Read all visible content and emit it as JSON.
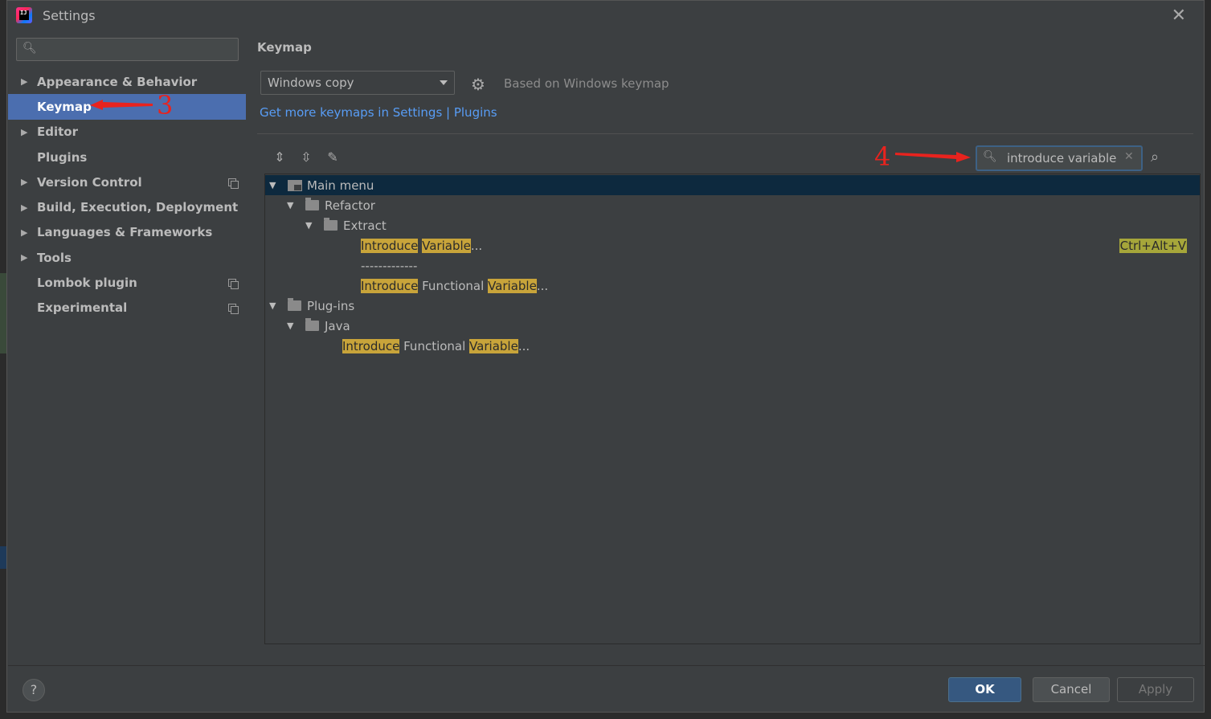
{
  "window": {
    "title": "Settings",
    "app_logo_text": "IJ"
  },
  "sidebar": {
    "search_placeholder": "",
    "items": [
      {
        "label": "Appearance & Behavior",
        "expandable": true,
        "selected": false,
        "project_level": false
      },
      {
        "label": "Keymap",
        "expandable": false,
        "selected": true,
        "project_level": false
      },
      {
        "label": "Editor",
        "expandable": true,
        "selected": false,
        "project_level": false
      },
      {
        "label": "Plugins",
        "expandable": false,
        "selected": false,
        "project_level": false
      },
      {
        "label": "Version Control",
        "expandable": true,
        "selected": false,
        "project_level": true
      },
      {
        "label": "Build, Execution, Deployment",
        "expandable": true,
        "selected": false,
        "project_level": false
      },
      {
        "label": "Languages & Frameworks",
        "expandable": true,
        "selected": false,
        "project_level": false
      },
      {
        "label": "Tools",
        "expandable": true,
        "selected": false,
        "project_level": false
      },
      {
        "label": "Lombok plugin",
        "expandable": false,
        "selected": false,
        "project_level": true
      },
      {
        "label": "Experimental",
        "expandable": false,
        "selected": false,
        "project_level": true
      }
    ]
  },
  "main": {
    "title": "Keymap",
    "keymap_select": "Windows copy",
    "based_on": "Based on Windows keymap",
    "more_link": "Get more keymaps in Settings | Plugins",
    "toolbar_icons": [
      "expand-all-icon",
      "collapse-all-icon",
      "edit-icon"
    ],
    "search_value": "introduce variable",
    "tree": {
      "main_menu": "Main menu",
      "refactor": "Refactor",
      "extract": "Extract",
      "introduce_variable": {
        "w1": "Introduce",
        "w2": "Variable",
        "rest": "...",
        "shortcut": "Ctrl+Alt+V"
      },
      "separator": "-------------",
      "introduce_functional_variable": {
        "w1": "Introduce",
        "mid": "Functional",
        "w2": "Variable",
        "rest": "..."
      },
      "plugins": "Plug-ins",
      "java": "Java",
      "java_introduce_functional_variable": {
        "w1": "Introduce",
        "mid": "Functional",
        "w2": "Variable",
        "rest": "..."
      }
    }
  },
  "buttons": {
    "ok": "OK",
    "cancel": "Cancel",
    "apply": "Apply",
    "help": "?"
  },
  "annotations": {
    "step3": "3",
    "step4": "4"
  },
  "colors": {
    "accent_selected": "#4b6eaf",
    "highlight": "#c8a43a",
    "link": "#589df6",
    "annotation": "#e8231e"
  }
}
